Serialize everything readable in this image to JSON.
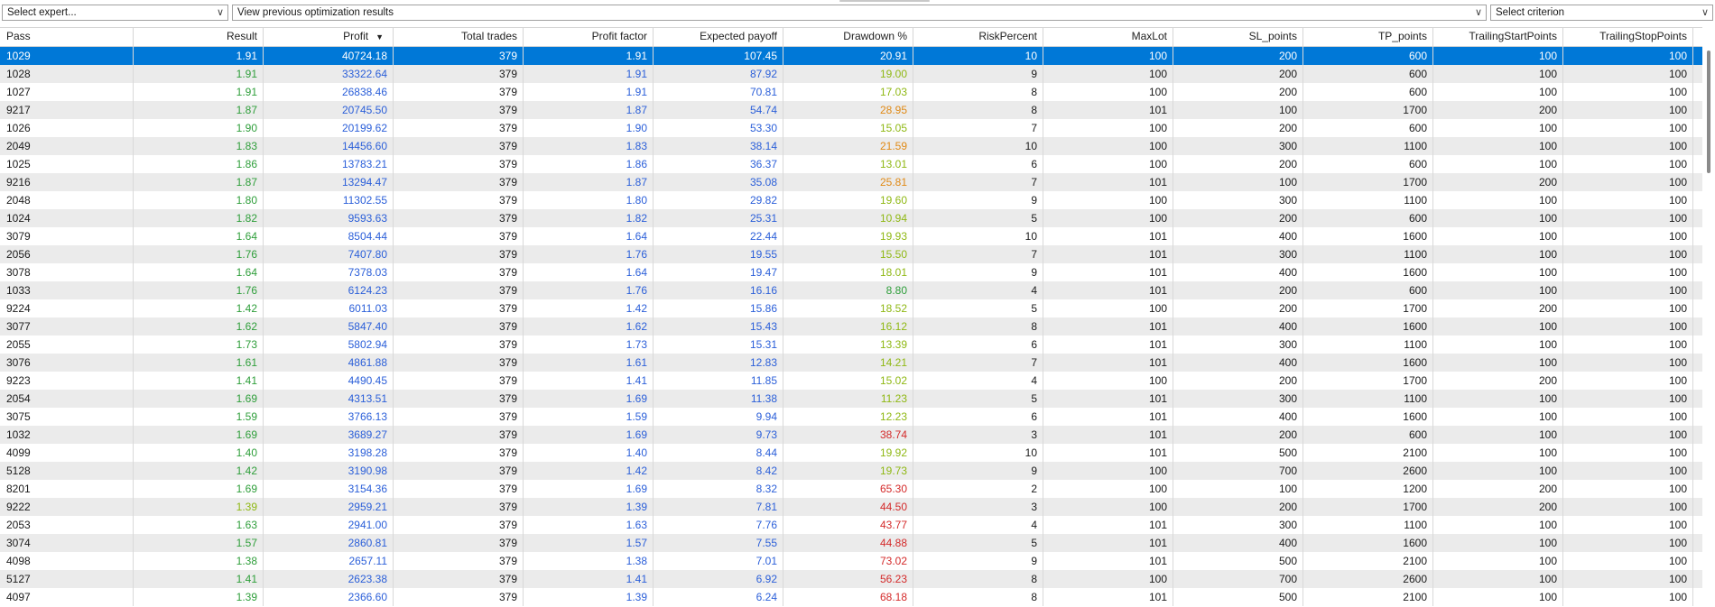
{
  "toolbar": {
    "expert_select": "Select expert...",
    "previous_results": "View previous optimization results",
    "criterion_select": "Select criterion"
  },
  "colors": {
    "selection": "#0078d7",
    "result_green": "#2e9e3a",
    "value_blue": "#2b5fd9",
    "dd_green": "#2e9e3a",
    "dd_lime": "#8fb814",
    "dd_orange": "#e08a16",
    "dd_red": "#d42a2a"
  },
  "table": {
    "sort_column": "Profit",
    "sort_direction": "descending",
    "columns": [
      "Pass",
      "Result",
      "Profit",
      "Total trades",
      "Profit factor",
      "Expected payoff",
      "Drawdown %",
      "RiskPercent",
      "MaxLot",
      "SL_points",
      "TP_points",
      "TrailingStartPoints",
      "TrailingStopPoints"
    ],
    "selected_pass": "1029",
    "rows": [
      {
        "pass": "1029",
        "result": "1.91",
        "profit": "40724.18",
        "trades": "379",
        "pf": "1.91",
        "payoff": "107.45",
        "dd": "20.91",
        "dd_color": "lime",
        "risk": "10",
        "maxlot": "100",
        "sl": "200",
        "tp": "600",
        "tstart": "100",
        "tstop": "100",
        "selected": true
      },
      {
        "pass": "1028",
        "result": "1.91",
        "profit": "33322.64",
        "trades": "379",
        "pf": "1.91",
        "payoff": "87.92",
        "dd": "19.00",
        "dd_color": "lime",
        "risk": "9",
        "maxlot": "100",
        "sl": "200",
        "tp": "600",
        "tstart": "100",
        "tstop": "100"
      },
      {
        "pass": "1027",
        "result": "1.91",
        "profit": "26838.46",
        "trades": "379",
        "pf": "1.91",
        "payoff": "70.81",
        "dd": "17.03",
        "dd_color": "lime",
        "risk": "8",
        "maxlot": "100",
        "sl": "200",
        "tp": "600",
        "tstart": "100",
        "tstop": "100"
      },
      {
        "pass": "9217",
        "result": "1.87",
        "profit": "20745.50",
        "trades": "379",
        "pf": "1.87",
        "payoff": "54.74",
        "dd": "28.95",
        "dd_color": "orange",
        "risk": "8",
        "maxlot": "101",
        "sl": "100",
        "tp": "1700",
        "tstart": "200",
        "tstop": "100"
      },
      {
        "pass": "1026",
        "result": "1.90",
        "profit": "20199.62",
        "trades": "379",
        "pf": "1.90",
        "payoff": "53.30",
        "dd": "15.05",
        "dd_color": "lime",
        "risk": "7",
        "maxlot": "100",
        "sl": "200",
        "tp": "600",
        "tstart": "100",
        "tstop": "100"
      },
      {
        "pass": "2049",
        "result": "1.83",
        "profit": "14456.60",
        "trades": "379",
        "pf": "1.83",
        "payoff": "38.14",
        "dd": "21.59",
        "dd_color": "orange",
        "risk": "10",
        "maxlot": "100",
        "sl": "300",
        "tp": "1100",
        "tstart": "100",
        "tstop": "100"
      },
      {
        "pass": "1025",
        "result": "1.86",
        "profit": "13783.21",
        "trades": "379",
        "pf": "1.86",
        "payoff": "36.37",
        "dd": "13.01",
        "dd_color": "lime",
        "risk": "6",
        "maxlot": "100",
        "sl": "200",
        "tp": "600",
        "tstart": "100",
        "tstop": "100"
      },
      {
        "pass": "9216",
        "result": "1.87",
        "profit": "13294.47",
        "trades": "379",
        "pf": "1.87",
        "payoff": "35.08",
        "dd": "25.81",
        "dd_color": "orange",
        "risk": "7",
        "maxlot": "101",
        "sl": "100",
        "tp": "1700",
        "tstart": "200",
        "tstop": "100"
      },
      {
        "pass": "2048",
        "result": "1.80",
        "profit": "11302.55",
        "trades": "379",
        "pf": "1.80",
        "payoff": "29.82",
        "dd": "19.60",
        "dd_color": "lime",
        "risk": "9",
        "maxlot": "100",
        "sl": "300",
        "tp": "1100",
        "tstart": "100",
        "tstop": "100"
      },
      {
        "pass": "1024",
        "result": "1.82",
        "profit": "9593.63",
        "trades": "379",
        "pf": "1.82",
        "payoff": "25.31",
        "dd": "10.94",
        "dd_color": "lime",
        "risk": "5",
        "maxlot": "100",
        "sl": "200",
        "tp": "600",
        "tstart": "100",
        "tstop": "100"
      },
      {
        "pass": "3079",
        "result": "1.64",
        "profit": "8504.44",
        "trades": "379",
        "pf": "1.64",
        "payoff": "22.44",
        "dd": "19.93",
        "dd_color": "lime",
        "risk": "10",
        "maxlot": "101",
        "sl": "400",
        "tp": "1600",
        "tstart": "100",
        "tstop": "100"
      },
      {
        "pass": "2056",
        "result": "1.76",
        "profit": "7407.80",
        "trades": "379",
        "pf": "1.76",
        "payoff": "19.55",
        "dd": "15.50",
        "dd_color": "lime",
        "risk": "7",
        "maxlot": "101",
        "sl": "300",
        "tp": "1100",
        "tstart": "100",
        "tstop": "100"
      },
      {
        "pass": "3078",
        "result": "1.64",
        "profit": "7378.03",
        "trades": "379",
        "pf": "1.64",
        "payoff": "19.47",
        "dd": "18.01",
        "dd_color": "lime",
        "risk": "9",
        "maxlot": "101",
        "sl": "400",
        "tp": "1600",
        "tstart": "100",
        "tstop": "100"
      },
      {
        "pass": "1033",
        "result": "1.76",
        "profit": "6124.23",
        "trades": "379",
        "pf": "1.76",
        "payoff": "16.16",
        "dd": "8.80",
        "dd_color": "green",
        "risk": "4",
        "maxlot": "101",
        "sl": "200",
        "tp": "600",
        "tstart": "100",
        "tstop": "100"
      },
      {
        "pass": "9224",
        "result": "1.42",
        "profit": "6011.03",
        "trades": "379",
        "pf": "1.42",
        "payoff": "15.86",
        "dd": "18.52",
        "dd_color": "lime",
        "risk": "5",
        "maxlot": "100",
        "sl": "200",
        "tp": "1700",
        "tstart": "200",
        "tstop": "100"
      },
      {
        "pass": "3077",
        "result": "1.62",
        "profit": "5847.40",
        "trades": "379",
        "pf": "1.62",
        "payoff": "15.43",
        "dd": "16.12",
        "dd_color": "lime",
        "risk": "8",
        "maxlot": "101",
        "sl": "400",
        "tp": "1600",
        "tstart": "100",
        "tstop": "100"
      },
      {
        "pass": "2055",
        "result": "1.73",
        "profit": "5802.94",
        "trades": "379",
        "pf": "1.73",
        "payoff": "15.31",
        "dd": "13.39",
        "dd_color": "lime",
        "risk": "6",
        "maxlot": "101",
        "sl": "300",
        "tp": "1100",
        "tstart": "100",
        "tstop": "100"
      },
      {
        "pass": "3076",
        "result": "1.61",
        "profit": "4861.88",
        "trades": "379",
        "pf": "1.61",
        "payoff": "12.83",
        "dd": "14.21",
        "dd_color": "lime",
        "risk": "7",
        "maxlot": "101",
        "sl": "400",
        "tp": "1600",
        "tstart": "100",
        "tstop": "100"
      },
      {
        "pass": "9223",
        "result": "1.41",
        "profit": "4490.45",
        "trades": "379",
        "pf": "1.41",
        "payoff": "11.85",
        "dd": "15.02",
        "dd_color": "lime",
        "risk": "4",
        "maxlot": "100",
        "sl": "200",
        "tp": "1700",
        "tstart": "200",
        "tstop": "100"
      },
      {
        "pass": "2054",
        "result": "1.69",
        "profit": "4313.51",
        "trades": "379",
        "pf": "1.69",
        "payoff": "11.38",
        "dd": "11.23",
        "dd_color": "lime",
        "risk": "5",
        "maxlot": "101",
        "sl": "300",
        "tp": "1100",
        "tstart": "100",
        "tstop": "100"
      },
      {
        "pass": "3075",
        "result": "1.59",
        "profit": "3766.13",
        "trades": "379",
        "pf": "1.59",
        "payoff": "9.94",
        "dd": "12.23",
        "dd_color": "lime",
        "risk": "6",
        "maxlot": "101",
        "sl": "400",
        "tp": "1600",
        "tstart": "100",
        "tstop": "100"
      },
      {
        "pass": "1032",
        "result": "1.69",
        "profit": "3689.27",
        "trades": "379",
        "pf": "1.69",
        "payoff": "9.73",
        "dd": "38.74",
        "dd_color": "red",
        "risk": "3",
        "maxlot": "101",
        "sl": "200",
        "tp": "600",
        "tstart": "100",
        "tstop": "100"
      },
      {
        "pass": "4099",
        "result": "1.40",
        "profit": "3198.28",
        "trades": "379",
        "pf": "1.40",
        "payoff": "8.44",
        "dd": "19.92",
        "dd_color": "lime",
        "risk": "10",
        "maxlot": "101",
        "sl": "500",
        "tp": "2100",
        "tstart": "100",
        "tstop": "100"
      },
      {
        "pass": "5128",
        "result": "1.42",
        "profit": "3190.98",
        "trades": "379",
        "pf": "1.42",
        "payoff": "8.42",
        "dd": "19.73",
        "dd_color": "lime",
        "risk": "9",
        "maxlot": "100",
        "sl": "700",
        "tp": "2600",
        "tstart": "100",
        "tstop": "100"
      },
      {
        "pass": "8201",
        "result": "1.69",
        "profit": "3154.36",
        "trades": "379",
        "pf": "1.69",
        "payoff": "8.32",
        "dd": "65.30",
        "dd_color": "red",
        "risk": "2",
        "maxlot": "100",
        "sl": "100",
        "tp": "1200",
        "tstart": "200",
        "tstop": "100"
      },
      {
        "pass": "9222",
        "result": "1.39",
        "profit": "2959.21",
        "trades": "379",
        "pf": "1.39",
        "payoff": "7.81",
        "dd": "44.50",
        "dd_color": "red",
        "risk": "3",
        "maxlot": "100",
        "sl": "200",
        "tp": "1700",
        "tstart": "200",
        "tstop": "100",
        "result_color": "lime"
      },
      {
        "pass": "2053",
        "result": "1.63",
        "profit": "2941.00",
        "trades": "379",
        "pf": "1.63",
        "payoff": "7.76",
        "dd": "43.77",
        "dd_color": "red",
        "risk": "4",
        "maxlot": "101",
        "sl": "300",
        "tp": "1100",
        "tstart": "100",
        "tstop": "100"
      },
      {
        "pass": "3074",
        "result": "1.57",
        "profit": "2860.81",
        "trades": "379",
        "pf": "1.57",
        "payoff": "7.55",
        "dd": "44.88",
        "dd_color": "red",
        "risk": "5",
        "maxlot": "101",
        "sl": "400",
        "tp": "1600",
        "tstart": "100",
        "tstop": "100"
      },
      {
        "pass": "4098",
        "result": "1.38",
        "profit": "2657.11",
        "trades": "379",
        "pf": "1.38",
        "payoff": "7.01",
        "dd": "73.02",
        "dd_color": "red",
        "risk": "9",
        "maxlot": "101",
        "sl": "500",
        "tp": "2100",
        "tstart": "100",
        "tstop": "100"
      },
      {
        "pass": "5127",
        "result": "1.41",
        "profit": "2623.38",
        "trades": "379",
        "pf": "1.41",
        "payoff": "6.92",
        "dd": "56.23",
        "dd_color": "red",
        "risk": "8",
        "maxlot": "100",
        "sl": "700",
        "tp": "2600",
        "tstart": "100",
        "tstop": "100"
      },
      {
        "pass": "4097",
        "result": "1.39",
        "profit": "2366.60",
        "trades": "379",
        "pf": "1.39",
        "payoff": "6.24",
        "dd": "68.18",
        "dd_color": "red",
        "risk": "8",
        "maxlot": "101",
        "sl": "500",
        "tp": "2100",
        "tstart": "100",
        "tstop": "100"
      }
    ]
  }
}
